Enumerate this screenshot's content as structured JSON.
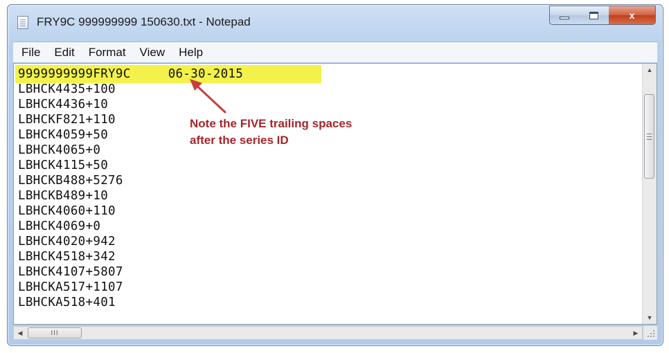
{
  "window": {
    "title": "FRY9C 999999999 150630.txt - Notepad",
    "icon": "notepad-icon"
  },
  "controls": {
    "minimize_icon": "minimize-icon",
    "maximize_icon": "maximize-icon",
    "close_label": "x"
  },
  "menu": [
    "File",
    "Edit",
    "Format",
    "View",
    "Help"
  ],
  "editor": {
    "highlight_color": "#f2f24a",
    "lines": [
      "9999999999FRY9C     06-30-2015",
      "LBHCK4435+100",
      "LBHCK4436+10",
      "LBHCKF821+110",
      "LBHCK4059+50",
      "LBHCK4065+0",
      "LBHCK4115+50",
      "LBHCKB488+5276",
      "LBHCKB489+10",
      "LBHCK4060+110",
      "LBHCK4069+0",
      "LBHCK4020+942",
      "LBHCK4518+342",
      "LBHCK4107+5807",
      "LBHCKA517+1107",
      "LBHCKA518+401"
    ]
  },
  "annotation": {
    "line1": "Note the FIVE trailing spaces",
    "line2": "after the series ID",
    "color": "#a3262a"
  },
  "scrollbars": {
    "horizontal_thumb_grip": "III",
    "vertical_thumb_grip": "grip-icon"
  }
}
